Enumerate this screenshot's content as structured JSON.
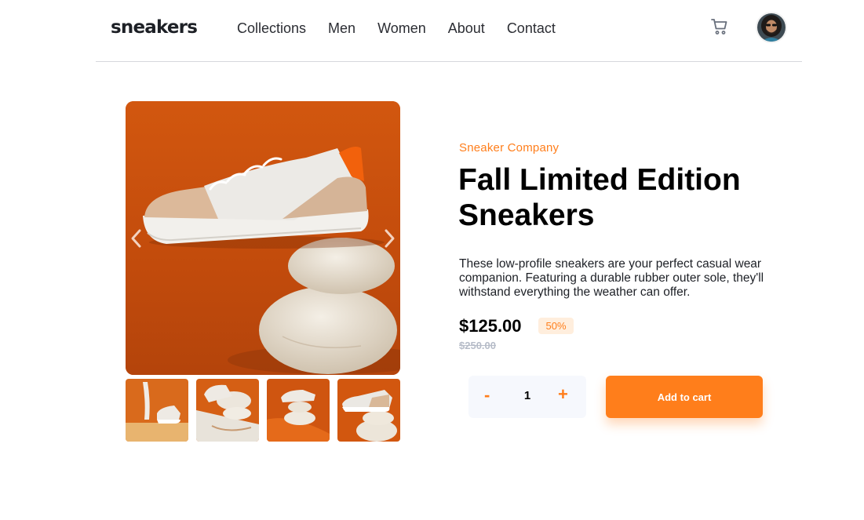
{
  "header": {
    "logo": "sneakers",
    "nav": [
      "Collections",
      "Men",
      "Women",
      "About",
      "Contact"
    ]
  },
  "product": {
    "company": "Sneaker Company",
    "title_line1": "Fall Limited Edition",
    "title_line2": "Sneakers",
    "description": "These low-profile sneakers are your perfect casual wear companion. Featuring a durable rubber outer sole, they'll withstand everything the weather can offer.",
    "price": "$125.00",
    "discount": "50%",
    "original_price": "$250.00"
  },
  "cart_controls": {
    "minus_label": "-",
    "quantity": "1",
    "plus_label": "+",
    "add_label": "Add to cart"
  },
  "colors": {
    "accent": "#ff7e1b",
    "accent_pale": "#ffeedd",
    "backdrop": "#c9500f"
  },
  "icons": {
    "cart": "cart-icon",
    "prev": "chevron-left-icon",
    "next": "chevron-right-icon"
  }
}
